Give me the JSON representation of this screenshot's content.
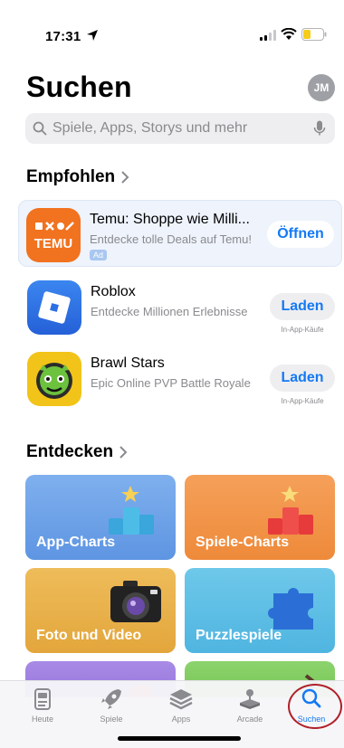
{
  "status_bar": {
    "time": "17:31"
  },
  "header": {
    "title": "Suchen",
    "avatar_initials": "JM"
  },
  "search": {
    "placeholder": "Spiele, Apps, Storys und mehr",
    "value": ""
  },
  "recommended": {
    "title": "Empfohlen",
    "apps": [
      {
        "name": "Temu: Shoppe wie Milli...",
        "subtitle": "Entdecke tolle Deals auf Temu!",
        "button": "Öffnen",
        "badge": "Ad",
        "icon": "temu-icon",
        "icon_text": "TEMU"
      },
      {
        "name": "Roblox",
        "subtitle": "Entdecke Millionen Erlebnisse",
        "button": "Laden",
        "iap": "In-App-Käufe",
        "icon": "roblox-icon"
      },
      {
        "name": "Brawl Stars",
        "subtitle": "Epic Online PVP Battle Royale",
        "button": "Laden",
        "iap": "In-App-Käufe",
        "icon": "brawl-stars-icon"
      }
    ]
  },
  "discover": {
    "title": "Entdecken",
    "tiles": [
      {
        "label": "App-Charts",
        "color": "#6aa3e8",
        "icon": "trophy-podium-icon"
      },
      {
        "label": "Spiele-Charts",
        "color": "#f19447",
        "icon": "trophy-podium-icon"
      },
      {
        "label": "Foto und Video",
        "color": "#e8b048",
        "icon": "camera-icon"
      },
      {
        "label": "Puzzlespiele",
        "color": "#5cbde4",
        "icon": "puzzle-icon"
      },
      {
        "label": "",
        "color": "#9f80e0",
        "icon": ""
      },
      {
        "label": "",
        "color": "#80cc60",
        "icon": ""
      }
    ]
  },
  "tabbar": {
    "tabs": [
      {
        "label": "Heute",
        "icon": "today-icon",
        "active": false
      },
      {
        "label": "Spiele",
        "icon": "rocket-icon",
        "active": false
      },
      {
        "label": "Apps",
        "icon": "stack-icon",
        "active": false
      },
      {
        "label": "Arcade",
        "icon": "joystick-icon",
        "active": false
      },
      {
        "label": "Suchen",
        "icon": "search-icon",
        "active": true
      }
    ]
  },
  "colors": {
    "accent": "#1479f5",
    "annotation": "#b0202a",
    "temu_orange": "#f1721f",
    "roblox_blue": "#2d74e8"
  }
}
